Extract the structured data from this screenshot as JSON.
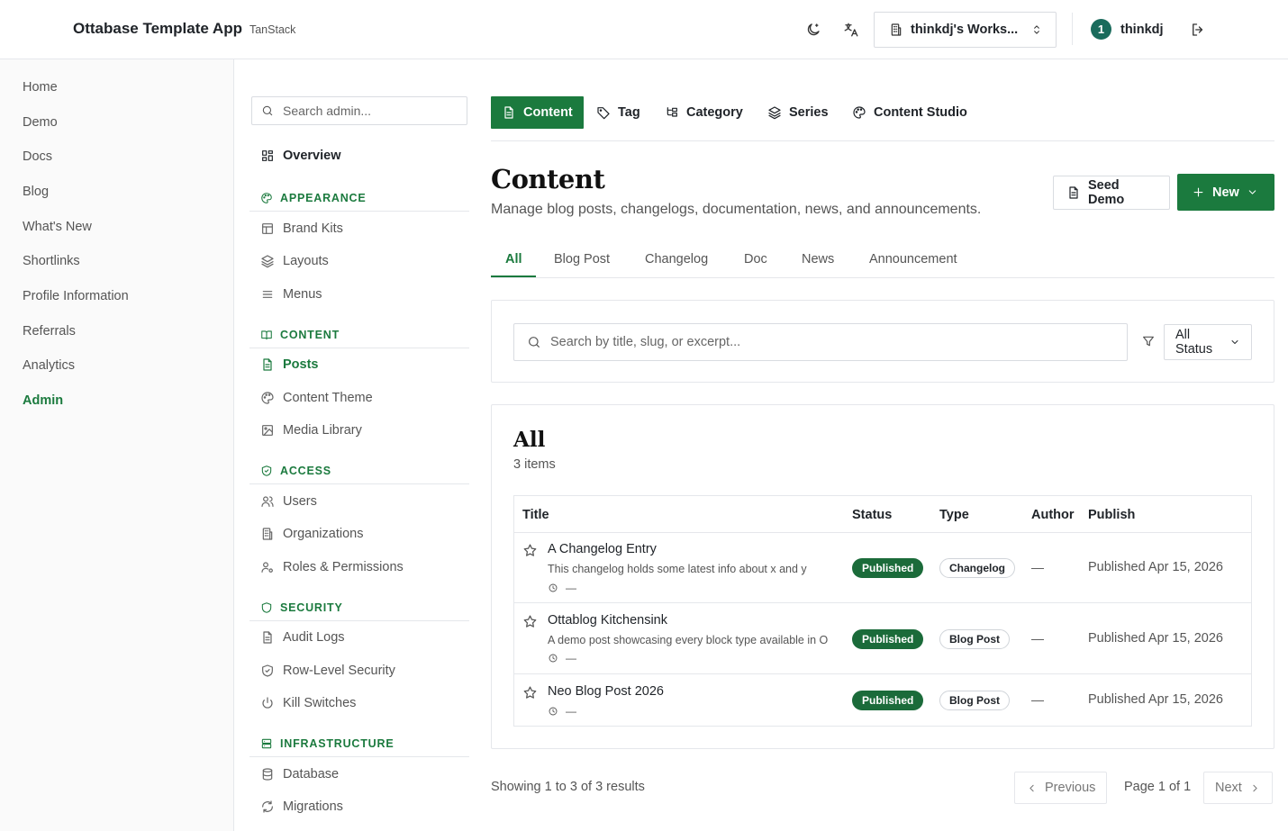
{
  "header": {
    "app_title": "Ottabase Template App",
    "app_subtitle": "TanStack",
    "workspace_label": "thinkdj's Works...",
    "user_avatar": "1",
    "user_name": "thinkdj"
  },
  "leftnav": {
    "items": [
      {
        "label": "Home"
      },
      {
        "label": "Demo"
      },
      {
        "label": "Docs"
      },
      {
        "label": "Blog"
      },
      {
        "label": "What's New"
      },
      {
        "label": "Shortlinks"
      },
      {
        "label": "Profile Information"
      },
      {
        "label": "Referrals"
      },
      {
        "label": "Analytics"
      },
      {
        "label": "Admin",
        "active": true
      }
    ]
  },
  "admin_sidebar": {
    "search_placeholder": "Search admin...",
    "overview": "Overview",
    "sections": {
      "appearance": {
        "title": "APPEARANCE",
        "items": [
          "Brand Kits",
          "Layouts",
          "Menus"
        ]
      },
      "content": {
        "title": "CONTENT",
        "items": [
          "Posts",
          "Content Theme",
          "Media Library"
        ]
      },
      "access": {
        "title": "ACCESS",
        "items": [
          "Users",
          "Organizations",
          "Roles & Permissions"
        ]
      },
      "security": {
        "title": "SECURITY",
        "items": [
          "Audit Logs",
          "Row-Level Security",
          "Kill Switches"
        ]
      },
      "infrastructure": {
        "title": "INFRASTRUCTURE",
        "items": [
          "Database",
          "Migrations"
        ]
      }
    }
  },
  "main": {
    "module_tabs": [
      "Content",
      "Tag",
      "Category",
      "Series",
      "Content Studio"
    ],
    "title": "Content",
    "subtitle": "Manage blog posts, changelogs, documentation, news, and announcements.",
    "seed_button": "Seed Demo",
    "new_button": "New",
    "type_tabs": [
      "All",
      "Blog Post",
      "Changelog",
      "Doc",
      "News",
      "Announcement"
    ],
    "search_placeholder": "Search by title, slug, or excerpt...",
    "status_filter": "All Status",
    "list": {
      "title": "All",
      "count": "3 items",
      "columns": [
        "Title",
        "Status",
        "Type",
        "Author",
        "Publish"
      ],
      "rows": [
        {
          "title": "A Changelog Entry",
          "excerpt": "This changelog holds some latest info about x and y",
          "meta": "—",
          "status": "Published",
          "type": "Changelog",
          "author": "—",
          "publish": "Published Apr 15, 2026"
        },
        {
          "title": "Ottablog Kitchensink",
          "excerpt": "A demo post showcasing every block type available in O",
          "meta": "—",
          "status": "Published",
          "type": "Blog Post",
          "author": "—",
          "publish": "Published Apr 15, 2026"
        },
        {
          "title": "Neo Blog Post 2026",
          "meta": "—",
          "status": "Published",
          "type": "Blog Post",
          "author": "—",
          "publish": "Published Apr 15, 2026"
        }
      ]
    },
    "pagination": {
      "results": "Showing 1 to 3 of 3 results",
      "previous": "Previous",
      "page": "Page 1 of 1",
      "next": "Next"
    }
  },
  "colors": {
    "accent": "#1b7a3e",
    "badge_published": "#1b6b3a",
    "avatar": "#1a6b5c",
    "border": "#e5e7eb"
  },
  "icons": {
    "theme_toggle": "moon-icon",
    "language": "translate-icon",
    "workspace": "building-icon",
    "logout": "logout-icon"
  }
}
